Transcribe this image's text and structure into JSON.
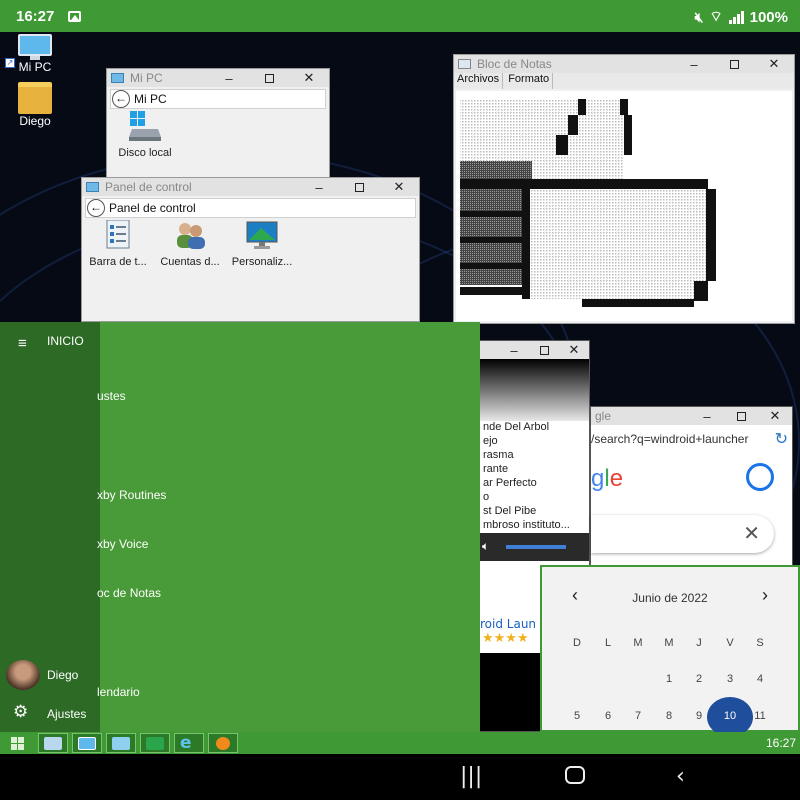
{
  "status_bar": {
    "time": "16:27",
    "battery": "100%"
  },
  "desktop": {
    "icons": [
      {
        "label": "Mi PC"
      },
      {
        "label": "Diego"
      }
    ]
  },
  "windows": {
    "mi_pc": {
      "title": "Mi PC",
      "address": "Mi PC",
      "items": [
        {
          "label": "Disco local"
        }
      ]
    },
    "control_panel": {
      "title": "Panel de control",
      "address": "Panel de control",
      "items": [
        {
          "label": "Barra de t..."
        },
        {
          "label": "Cuentas d..."
        },
        {
          "label": "Personaliz..."
        }
      ]
    },
    "notepad": {
      "title": "Bloc de Notas",
      "menu": [
        "Archivos",
        "Formato"
      ]
    },
    "music": {
      "songs": [
        "nde Del Arbol",
        "ejo",
        "rasma",
        "rante",
        "ar Perfecto",
        "o",
        "st Del Pibe",
        "mbroso instituto..."
      ]
    },
    "chrome": {
      "title_fragment": "gle",
      "url": "/search?q=windroid+launcher",
      "logo_fragment": "gle",
      "result_fragment": "roid Laun"
    }
  },
  "calendar": {
    "month_title": "Junio de 2022",
    "weekday_headers": [
      "D",
      "L",
      "M",
      "M",
      "J",
      "V",
      "S"
    ],
    "week1": [
      "1",
      "2",
      "3",
      "4"
    ],
    "week2": [
      "5",
      "6",
      "7",
      "8",
      "9",
      "10",
      "11"
    ],
    "selected_day": "10"
  },
  "start_menu": {
    "header": "INICIO",
    "items": [
      "ustes",
      "xby Routines",
      "xby Voice",
      "oc de Notas",
      "lendario"
    ],
    "user_name": "Diego",
    "settings_label": "Ajustes"
  },
  "taskbar": {
    "clock": "16:27"
  },
  "colors": {
    "accent_green": "#3f9a35",
    "rail_green": "#2c6a25",
    "selected_blue": "#1e4e9c"
  }
}
